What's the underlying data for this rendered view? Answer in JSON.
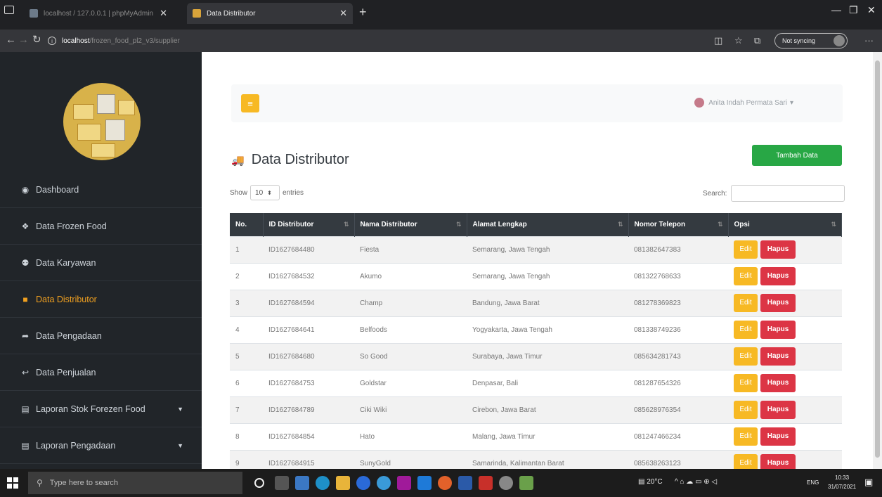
{
  "browser": {
    "inactive_tab": "localhost / 127.0.0.1 | phpMyAdmin",
    "active_tab": "Data Distributor",
    "url_host": "localhost",
    "url_path": "/frozen_food_pl2_v3/supplier",
    "sync_label": "Not syncing"
  },
  "sidebar": {
    "items": [
      {
        "label": "Dashboard",
        "icon": "tachometer-icon"
      },
      {
        "label": "Data Frozen Food",
        "icon": "cubes-icon"
      },
      {
        "label": "Data Karyawan",
        "icon": "users-icon"
      },
      {
        "label": "Data Distributor",
        "icon": "truck-icon"
      },
      {
        "label": "Data Pengadaan",
        "icon": "share-icon"
      },
      {
        "label": "Data Penjualan",
        "icon": "reply-icon"
      },
      {
        "label": "Laporan Stok Forezen Food",
        "icon": "file-icon"
      },
      {
        "label": "Laporan Pengadaan",
        "icon": "file-icon"
      }
    ]
  },
  "topnav": {
    "user_name": "Anita Indah Permata Sari"
  },
  "page": {
    "title": "Data Distributor",
    "add_button": "Tambah Data",
    "show_label": "Show",
    "entries_value": "10",
    "entries_label": "entries",
    "search_label": "Search:"
  },
  "table": {
    "headers": [
      "No.",
      "ID Distributor",
      "Nama Distributor",
      "Alamat Lengkap",
      "Nomor Telepon",
      "Opsi"
    ],
    "edit_label": "Edit",
    "delete_label": "Hapus",
    "rows": [
      [
        "1",
        "ID1627684480",
        "Fiesta",
        "Semarang, Jawa Tengah",
        "081382647383"
      ],
      [
        "2",
        "ID1627684532",
        "Akumo",
        "Semarang, Jawa Tengah",
        "081322768633"
      ],
      [
        "3",
        "ID1627684594",
        "Champ",
        "Bandung, Jawa Barat",
        "081278369823"
      ],
      [
        "4",
        "ID1627684641",
        "Belfoods",
        "Yogyakarta, Jawa Tengah",
        "081338749236"
      ],
      [
        "5",
        "ID1627684680",
        "So Good",
        "Surabaya, Jawa Timur",
        "085634281743"
      ],
      [
        "6",
        "ID1627684753",
        "Goldstar",
        "Denpasar, Bali",
        "081287654326"
      ],
      [
        "7",
        "ID1627684789",
        "Ciki Wiki",
        "Cirebon, Jawa Barat",
        "085628976354"
      ],
      [
        "8",
        "ID1627684854",
        "Hato",
        "Malang, Jawa Timur",
        "081247466234"
      ],
      [
        "9",
        "ID1627684915",
        "SunyGold",
        "Samarinda, Kalimantan Barat",
        "085638263123"
      ]
    ]
  },
  "taskbar": {
    "search_placeholder": "Type here to search",
    "weather": "20°C",
    "lang": "ENG",
    "time": "10:33",
    "date": "31/07/2021"
  },
  "colors": {
    "sidebar_bg": "#212529",
    "accent_yellow": "#f7b924",
    "add_green": "#28a745",
    "delete_red": "#dc3545",
    "table_header": "#343a40"
  }
}
